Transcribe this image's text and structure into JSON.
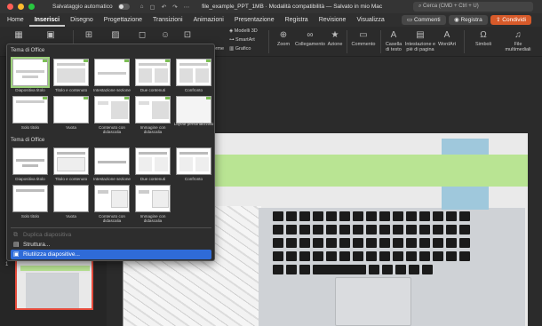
{
  "window": {
    "autosave_label": "Salvataggio automatico",
    "doc_title": "file_example_PPT_1MB  ·  Modalità compatibilità — Salvato in mio Mac",
    "search_placeholder": "Cerca (CMD + Ctrl + U)",
    "quick_access": [
      "⌂",
      "▢",
      "↶",
      "↷",
      "⋯"
    ]
  },
  "tabs": [
    "Home",
    "Inserisci",
    "Disegno",
    "Progettazione",
    "Transizioni",
    "Animazioni",
    "Presentazione",
    "Registra",
    "Revisione",
    "Visualizza"
  ],
  "active_tab": "Inserisci",
  "header_actions": {
    "comments": "Commenti",
    "record": "Registra",
    "share": "Condividi"
  },
  "ribbon": {
    "forme": "forme",
    "models3d": "Modelli 3D",
    "smartart": "SmartArt",
    "grafico": "Grafico",
    "zoom": "Zoom",
    "collegamento": "Collegamento",
    "azione": "Azione",
    "commento": "Commento",
    "casella": "Casella di testo",
    "intestazione": "Intestazione e piè di pagina",
    "wordart": "WordArt",
    "simboli": "Simboli",
    "file_multimediali": "File multimediali"
  },
  "dropdown": {
    "section1": "Tema di Office",
    "section2": "Tema di Office",
    "layouts1": [
      "Diapositiva titolo",
      "Titolo e contenuto",
      "Intestazione sezione",
      "Due contenuti",
      "Confronto",
      "Solo titolo",
      "Vuota",
      "Contenuto con didascalia",
      "Immagine con didascalia",
      "Layout personalizzato"
    ],
    "layouts2": [
      "Diapositiva titolo",
      "Titolo e contenuto",
      "Intestazione sezione",
      "Due contenuti",
      "Confronto",
      "Solo titolo",
      "Vuota",
      "Contenuto con didascalia",
      "Immagine con didascalia"
    ],
    "menu": [
      {
        "label": "Duplica diapositiva",
        "state": "disabled"
      },
      {
        "label": "Struttura...",
        "state": "normal"
      },
      {
        "label": "Riutilizza diapositive...",
        "state": "highlighted"
      }
    ]
  },
  "slide_panel": {
    "thumb_number": "1"
  },
  "colors": {
    "accent_green": "#b9e493",
    "accent_blue": "#9fc8dc",
    "share_orange": "#d75a2a",
    "highlight_blue": "#2f6bd8"
  }
}
